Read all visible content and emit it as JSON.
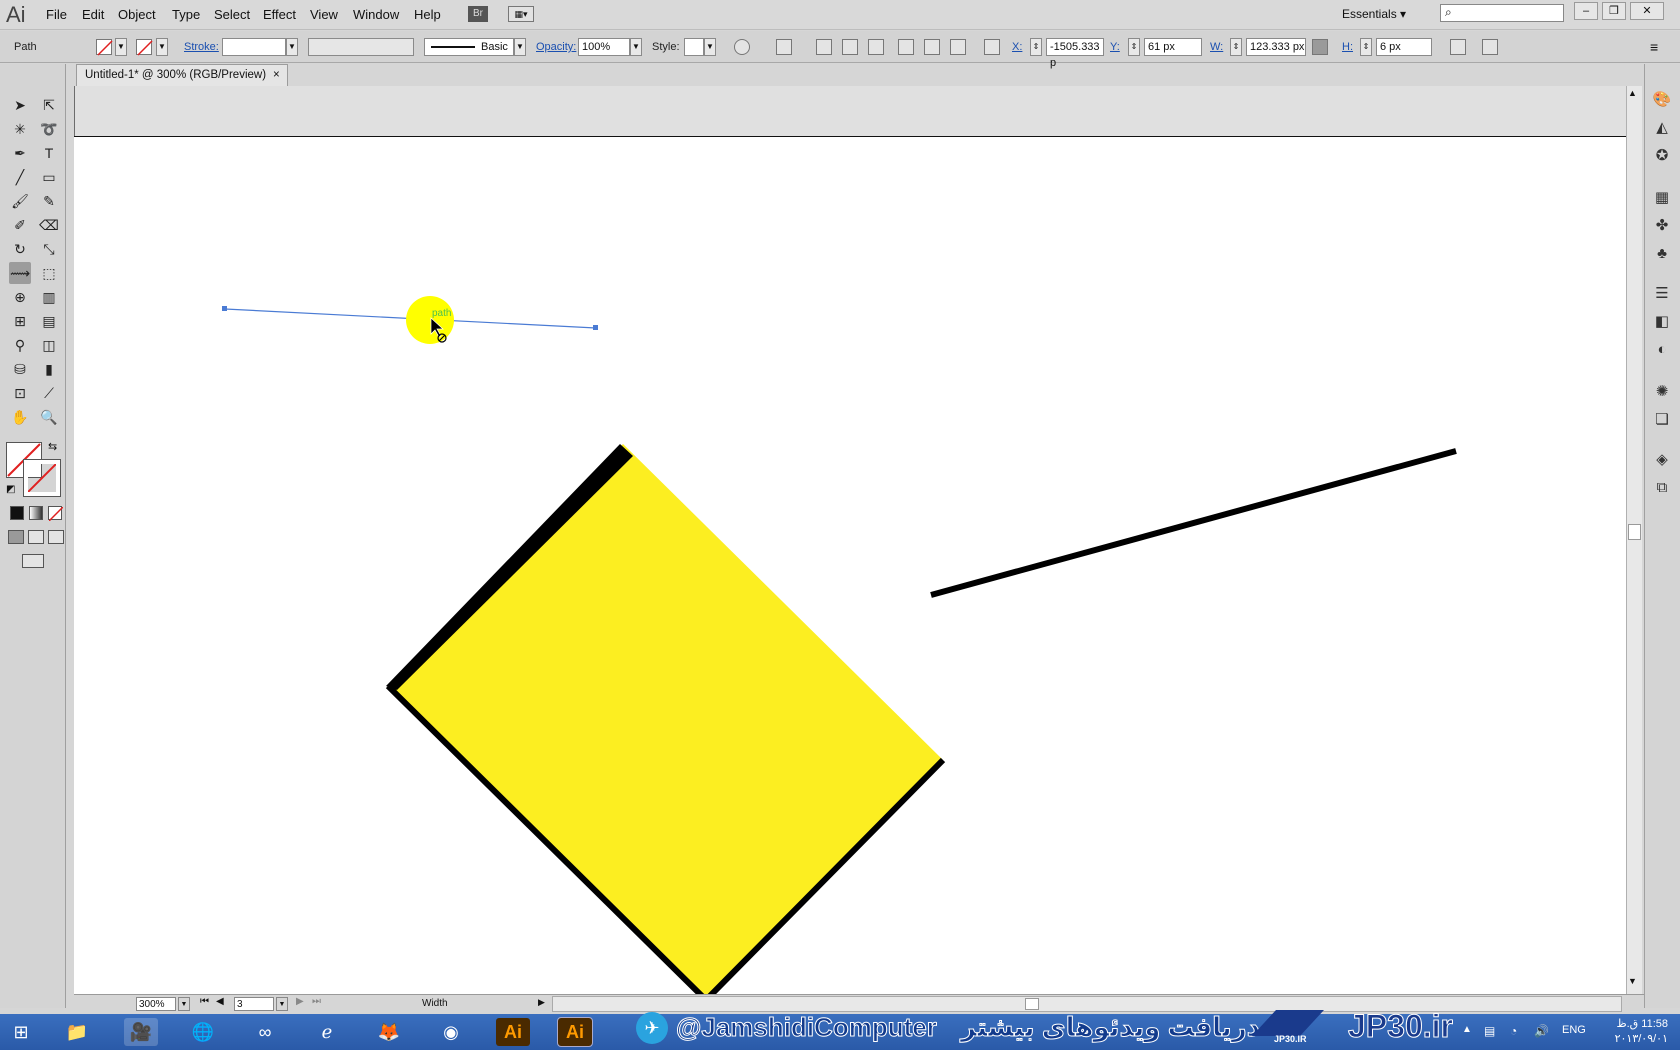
{
  "app": {
    "logo": "Ai",
    "menus": [
      "File",
      "Edit",
      "Object",
      "Type",
      "Select",
      "Effect",
      "View",
      "Window",
      "Help"
    ],
    "bridge_label": "Br",
    "workspace": "Essentials"
  },
  "controlbar": {
    "selection_label": "Path",
    "stroke_label": "Stroke:",
    "brush_label": "Basic",
    "opacity_label": "Opacity:",
    "opacity_value": "100%",
    "style_label": "Style:",
    "x_label": "X:",
    "x_value": "-1505.333 p",
    "y_label": "Y:",
    "y_value": "61 px",
    "w_label": "W:",
    "w_value": "123.333 px",
    "h_label": "H:",
    "h_value": "6 px"
  },
  "document": {
    "tab_title": "Untitled-1* @ 300% (RGB/Preview)",
    "tab_close": "×",
    "smart_guide_label": "path"
  },
  "statusbar": {
    "zoom_value": "300%",
    "artboard_value": "3",
    "tool_name": "Width"
  },
  "taskbar": {
    "telegram_handle": "@JamshidiComputer",
    "promo_text": "دریافت ویدئوهای بیشتر",
    "site": "JP30.ir",
    "logo_caption": "JP30.IR",
    "language": "ENG",
    "time": "11:58 ق.ظ",
    "date": "۲۰۱۳/۰۹/۰۱"
  },
  "colors": {
    "shape_fill": "#fcee21",
    "stroke": "#000000",
    "selection": "#4a7bd4",
    "highlight": "#ffff00"
  }
}
